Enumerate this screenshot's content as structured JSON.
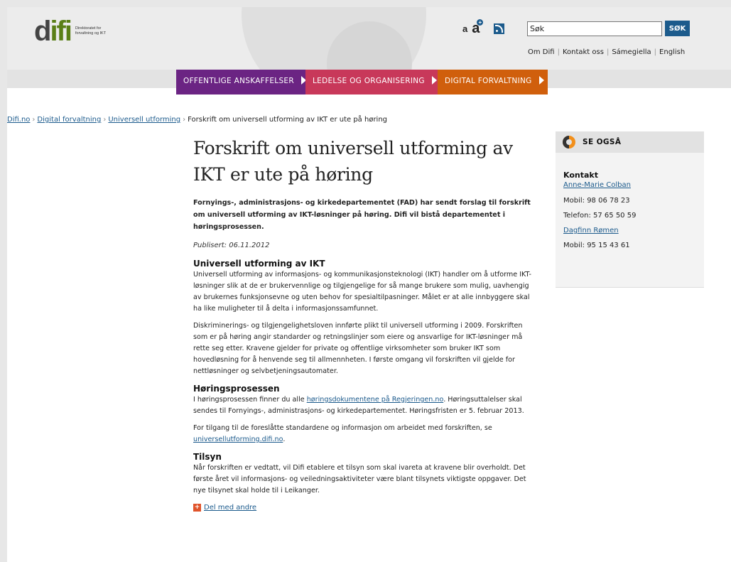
{
  "header": {
    "logo_text": "difi",
    "logo_tagline_1": "Direktoratet for",
    "logo_tagline_2": "forvaltning og IKT",
    "text_small": "a",
    "text_large": "a",
    "search": {
      "value": "Søk",
      "button": "SØK"
    },
    "links": [
      "Om Difi",
      "Kontakt oss",
      "Sámegiella",
      "English"
    ],
    "separator": "|"
  },
  "nav": {
    "items": [
      {
        "label": "OFFENTLIGE ANSKAFFELSER",
        "color": "#6b2483"
      },
      {
        "label": "LEDELSE OG ORGANISERING",
        "color": "#c8385a"
      },
      {
        "label": "DIGITAL FORVALTNING",
        "color": "#d05f0c"
      }
    ]
  },
  "breadcrumb": {
    "items": [
      "Difi.no",
      "Digital forvaltning",
      "Universell utforming"
    ],
    "current": "Forskrift om universell utforming av IKT er ute på høring",
    "separator": "›"
  },
  "article": {
    "title": "Forskrift om universell utforming av IKT er ute på høring",
    "lead": "Fornyings-, administrasjons- og kirkedepartementet (FAD) har sendt forslag til forskrift om universell utforming av IKT-løsninger på høring. Difi vil bistå departementet i høringsprosessen.",
    "published": "Publisert: 06.11.2012",
    "sections": [
      {
        "heading": "Universell utforming av IKT",
        "p1": "Universell utforming av informasjons- og kommunikasjonsteknologi (IKT) handler om å utforme IKT-løsninger slik at de er brukervennlige og tilgjengelige for så mange brukere som mulig, uavhengig av brukernes funksjonsevne og uten behov for spesialtilpasninger. Målet er at alle innbyggere skal ha like muligheter til å delta i informasjonssamfunnet.",
        "p2": "Diskriminerings- og tilgjengelighetsloven innførte plikt til universell utforming i 2009. Forskriften som er på høring angir standarder og retningslinjer som eiere og ansvarlige for IKT-løsninger må rette seg etter. Kravene gjelder for private og offentlige virksomheter som bruker IKT som hovedløsning for å henvende seg til allmennheten. I første omgang vil forskriften vil gjelde for nettløsninger og selvbetjeningsautomater."
      },
      {
        "heading": "Høringsprosessen",
        "p1_pre": "I høringsprosessen finner du alle ",
        "p1_link": "høringsdokumentene på Regjeringen.no",
        "p1_post": ". Høringsuttalelser skal sendes til Fornyings-, administrasjons- og kirkedepartementet. Høringsfristen er 5. februar 2013.",
        "p2_pre": "For tilgang til de foreslåtte standardene og informasjon om arbeidet med forskriften, se ",
        "p2_link": "universellutforming.difi.no",
        "p2_post": "."
      },
      {
        "heading": "Tilsyn",
        "p1": "Når forskriften er vedtatt, vil Difi etablere et tilsyn som skal ivareta at kravene blir overholdt. Det første året vil informasjons- og veiledningsaktiviteter være blant tilsynets viktigste oppgaver. Det nye tilsynet skal holde til i Leikanger."
      }
    ],
    "share": {
      "icon_text": "+",
      "label": "Del med andre"
    }
  },
  "sidebar": {
    "title": "SE OGSÅ",
    "contact_heading": "Kontakt",
    "person1": {
      "name": "Anne-Marie Colban",
      "mobile": "Mobil: 98 06 78 23",
      "phone": "Telefon: 57 65 50 59"
    },
    "person2": {
      "name": "Dagfinn Rømen",
      "mobile": "Mobil: 95 15 43 61"
    }
  }
}
